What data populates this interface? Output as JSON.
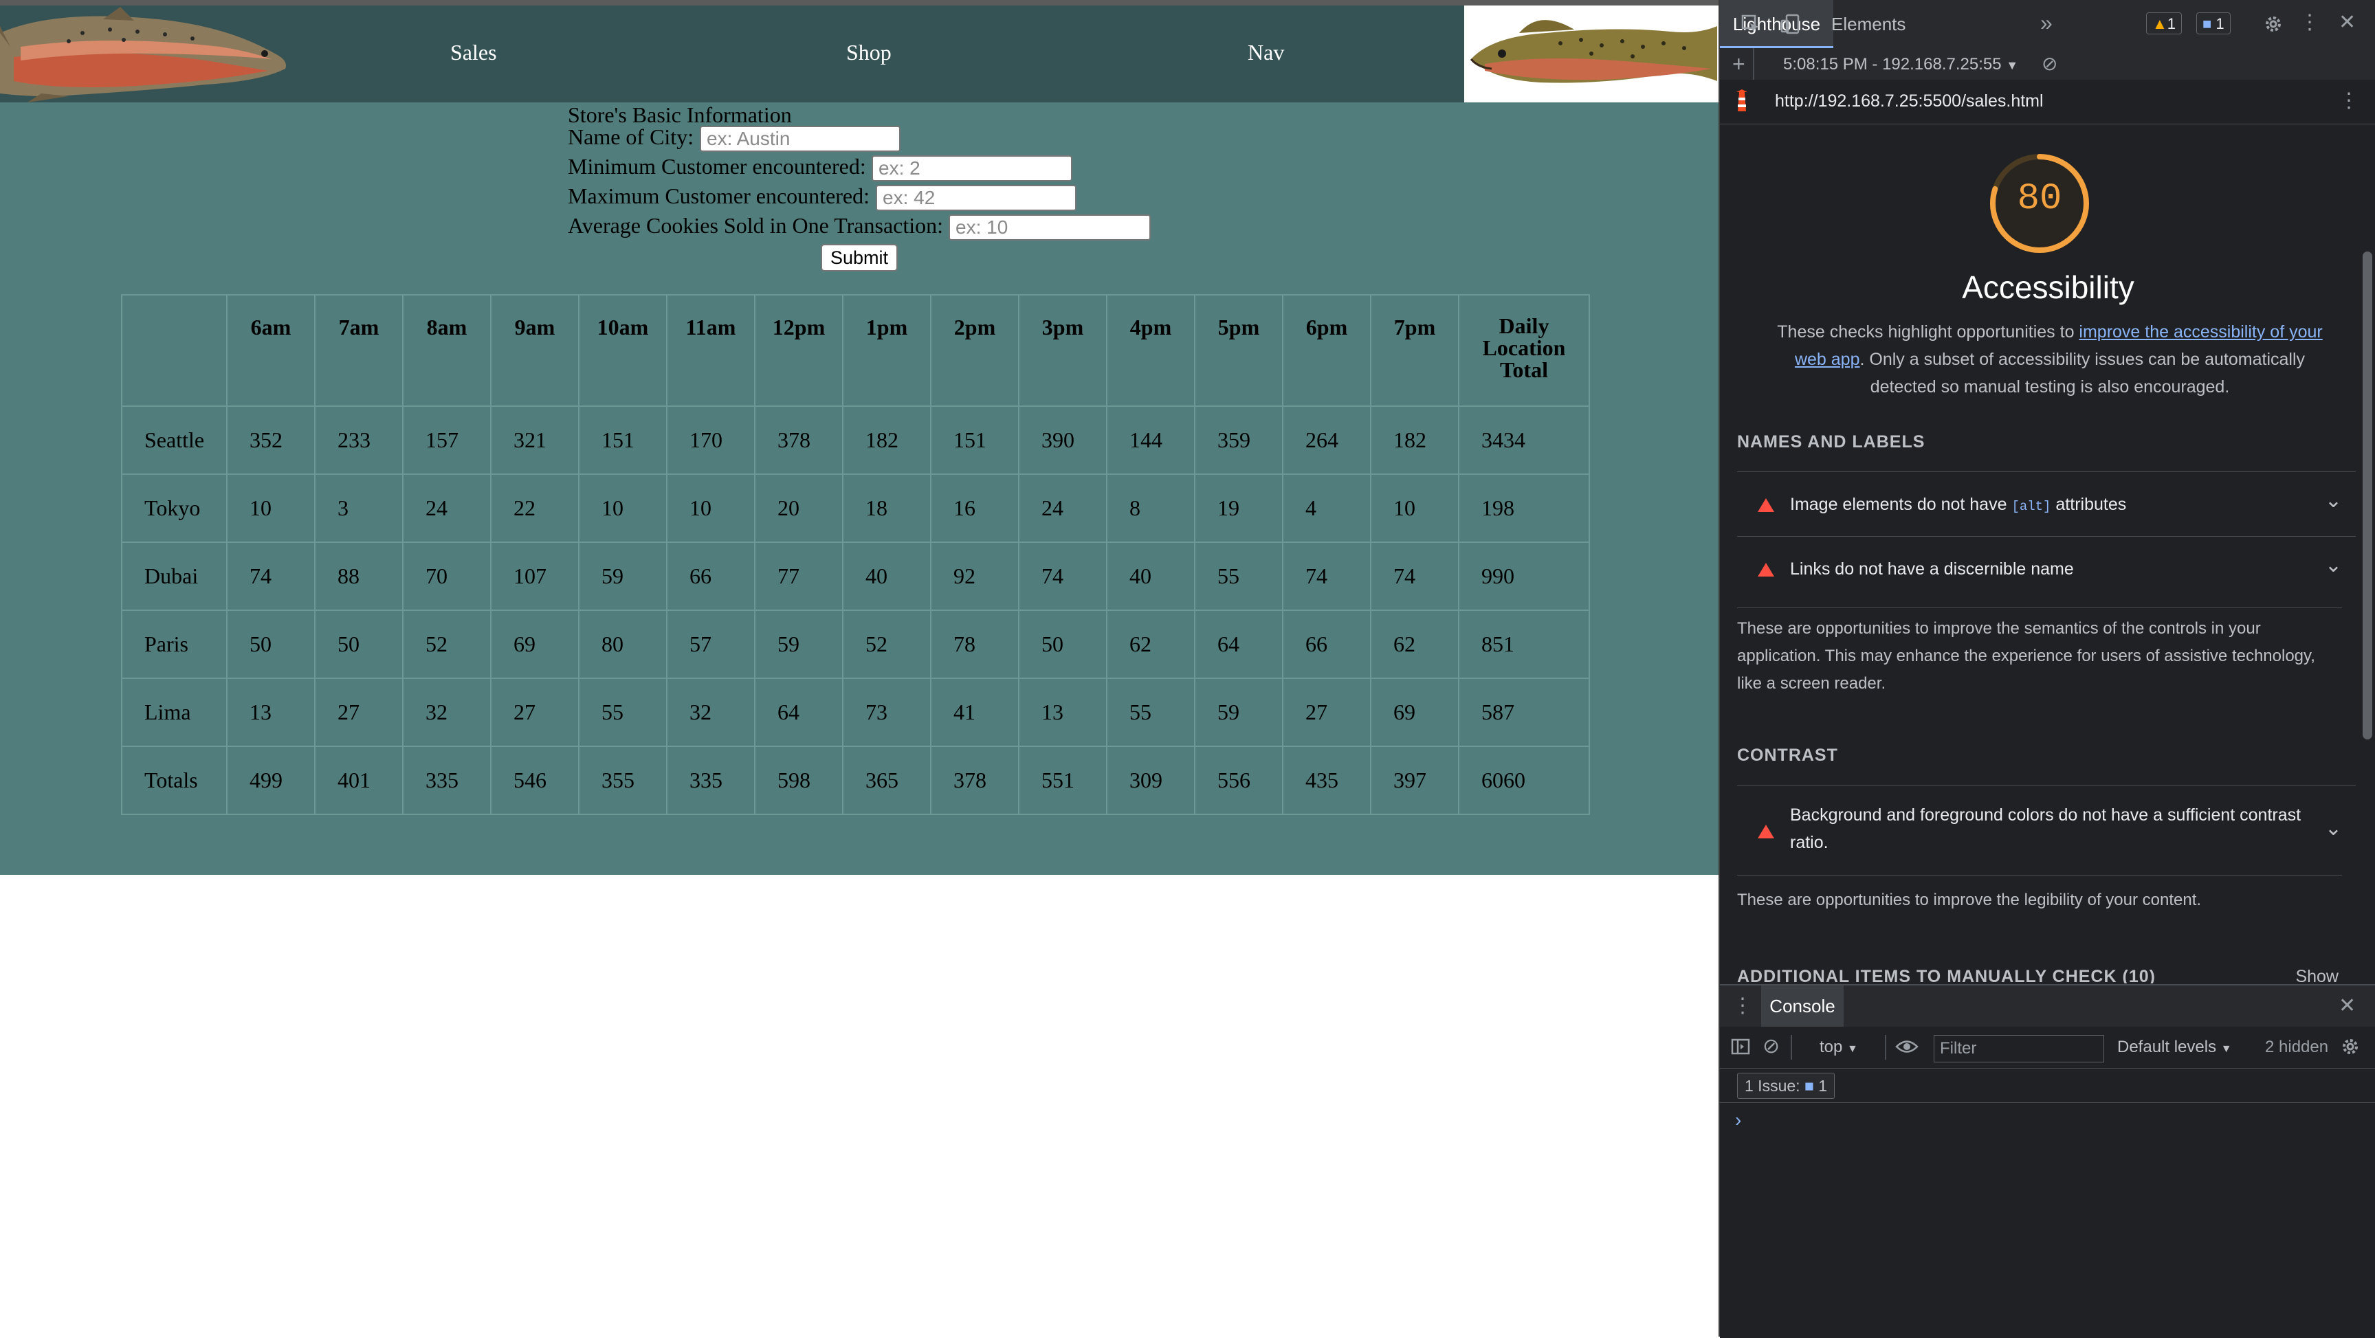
{
  "nav": {
    "sales": "Sales",
    "shop": "Shop",
    "nav": "Nav"
  },
  "form": {
    "heading": "Store's Basic Information",
    "city_label": "Name of City:",
    "city_placeholder": "ex: Austin",
    "min_label": "Minimum Customer encountered:",
    "min_placeholder": "ex: 2",
    "max_label": "Maximum Customer encountered:",
    "max_placeholder": "ex: 42",
    "avg_label": "Average Cookies Sold in One Transaction:",
    "avg_placeholder": "ex: 10",
    "submit": "Submit"
  },
  "table": {
    "hours": [
      "6am",
      "7am",
      "8am",
      "9am",
      "10am",
      "11am",
      "12pm",
      "1pm",
      "2pm",
      "3pm",
      "4pm",
      "5pm",
      "6pm",
      "7pm"
    ],
    "total_header": "Daily Location Total",
    "rows": [
      {
        "name": "Seattle",
        "values": [
          352,
          233,
          157,
          321,
          151,
          170,
          378,
          182,
          151,
          390,
          144,
          359,
          264,
          182
        ],
        "total": 3434
      },
      {
        "name": "Tokyo",
        "values": [
          10,
          3,
          24,
          22,
          10,
          10,
          20,
          18,
          16,
          24,
          8,
          19,
          4,
          10
        ],
        "total": 198
      },
      {
        "name": "Dubai",
        "values": [
          74,
          88,
          70,
          107,
          59,
          66,
          77,
          40,
          92,
          74,
          40,
          55,
          74,
          74
        ],
        "total": 990
      },
      {
        "name": "Paris",
        "values": [
          50,
          50,
          52,
          69,
          80,
          57,
          59,
          52,
          78,
          50,
          62,
          64,
          66,
          62
        ],
        "total": 851
      },
      {
        "name": "Lima",
        "values": [
          13,
          27,
          32,
          27,
          55,
          32,
          64,
          73,
          41,
          13,
          55,
          59,
          27,
          69
        ],
        "total": 587
      },
      {
        "name": "Totals",
        "values": [
          499,
          401,
          335,
          546,
          355,
          335,
          598,
          365,
          378,
          551,
          309,
          556,
          435,
          397
        ],
        "total": 6060
      }
    ]
  },
  "devtools": {
    "tabs": {
      "elements": "Elements",
      "lighthouse": "Lighthouse"
    },
    "warning_count": "1",
    "info_count": "1",
    "report_time": "5:08:15 PM - 192.168.7.25:55",
    "url": "http://192.168.7.25:5500/sales.html",
    "score": "80",
    "score_value": 0.8,
    "score_color": "#f4a240",
    "category_title": "Accessibility",
    "desc_pre": "These checks highlight opportunities to ",
    "desc_link": "improve the accessibility of your web app",
    "desc_post": ". Only a subset of accessibility issues can be automatically detected so manual testing is also encouraged.",
    "section_names": "NAMES AND LABELS",
    "audit_img_pre": "Image elements do not have ",
    "audit_img_code": "[alt]",
    "audit_img_post": " attributes",
    "audit_links": "Links do not have a discernible name",
    "names_note": "These are opportunities to improve the semantics of the controls in your application. This may enhance the experience for users of assistive technology, like a screen reader.",
    "section_contrast": "CONTRAST",
    "audit_contrast": "Background and foreground colors do not have a sufficient contrast ratio.",
    "contrast_note": "These are opportunities to improve the legibility of your content.",
    "section_manual": "ADDITIONAL ITEMS TO MANUALLY CHECK (10)",
    "show": "Show"
  },
  "console": {
    "tab": "Console",
    "context": "top",
    "filter_placeholder": "Filter",
    "levels": "Default levels",
    "hidden": "2 hidden",
    "issues_label": "1 Issue:",
    "issues_count": "1",
    "prompt": "›"
  }
}
